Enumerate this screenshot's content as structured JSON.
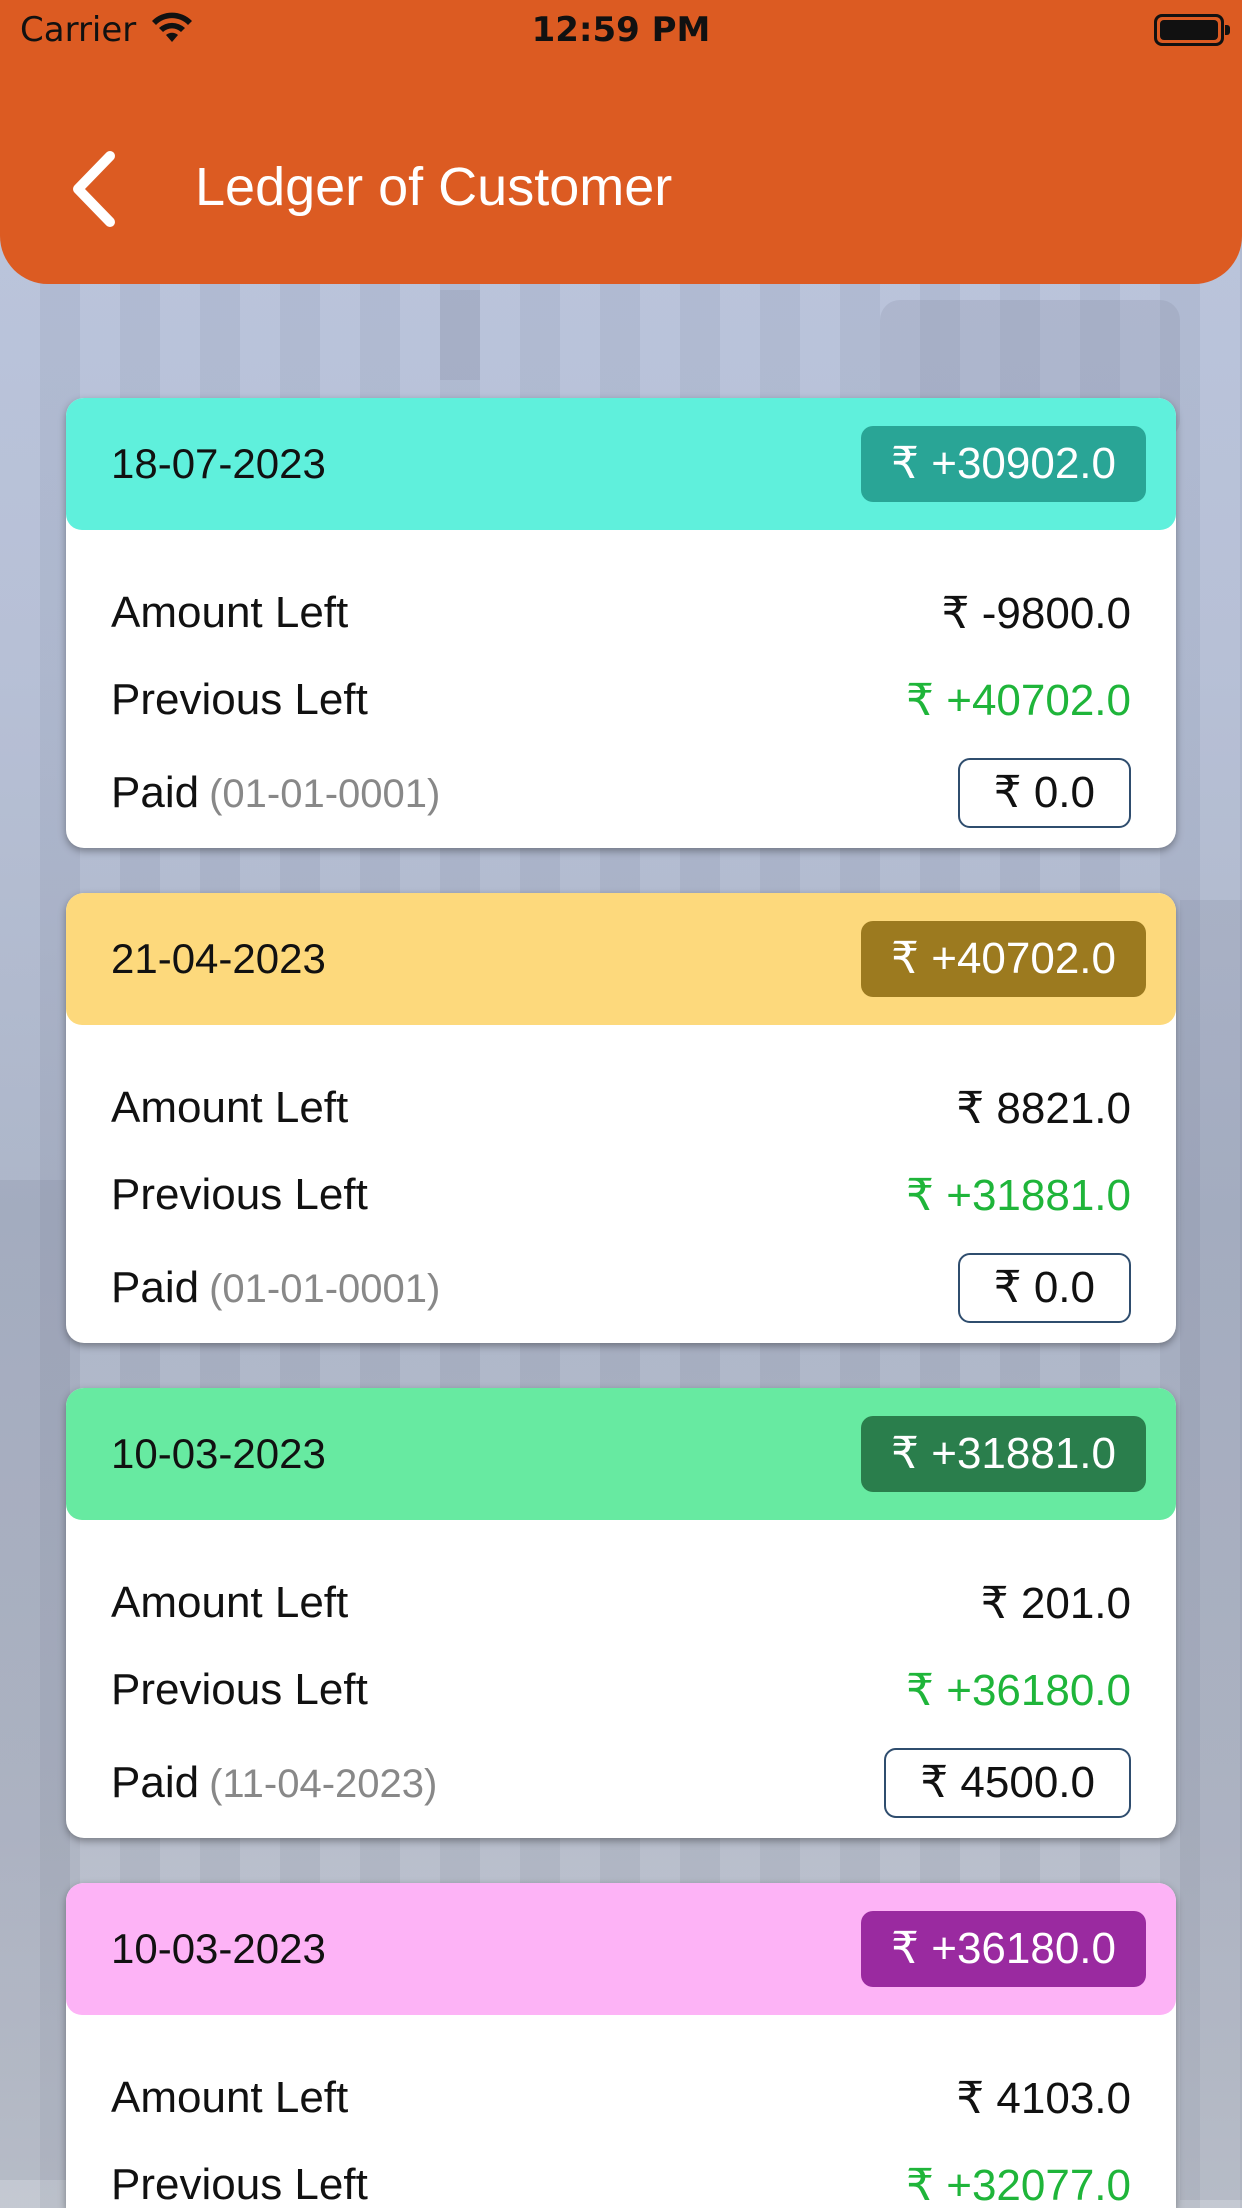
{
  "status_bar": {
    "carrier": "Carrier",
    "time": "12:59 PM"
  },
  "header": {
    "title": "Ledger of Customer",
    "back_icon": "chevron-left-icon"
  },
  "labels": {
    "amount_left": "Amount Left",
    "previous_left": "Previous Left",
    "paid": "Paid"
  },
  "entries": [
    {
      "date": "18-07-2023",
      "total": "₹ +30902.0",
      "amount_left": "₹ -9800.0",
      "previous_left": "₹ +40702.0",
      "paid_date": "(01-01-0001)",
      "paid": "₹ 0.0",
      "head_color": "#5ff0dc",
      "badge_color": "#29a596"
    },
    {
      "date": "21-04-2023",
      "total": "₹ +40702.0",
      "amount_left": "₹ 8821.0",
      "previous_left": "₹ +31881.0",
      "paid_date": "(01-01-0001)",
      "paid": "₹ 0.0",
      "head_color": "#fdd97c",
      "badge_color": "#9c7a1f"
    },
    {
      "date": "10-03-2023",
      "total": "₹ +31881.0",
      "amount_left": "₹ 201.0",
      "previous_left": "₹ +36180.0",
      "paid_date": "(11-04-2023)",
      "paid": "₹ 4500.0",
      "head_color": "#67eaa1",
      "badge_color": "#2a7e4c"
    },
    {
      "date": "10-03-2023",
      "total": "₹ +36180.0",
      "amount_left": "₹ 4103.0",
      "previous_left": "₹ +32077.0",
      "paid_date": "",
      "paid": "",
      "head_color": "#fdb3f6",
      "badge_color": "#9a2aa0"
    }
  ]
}
